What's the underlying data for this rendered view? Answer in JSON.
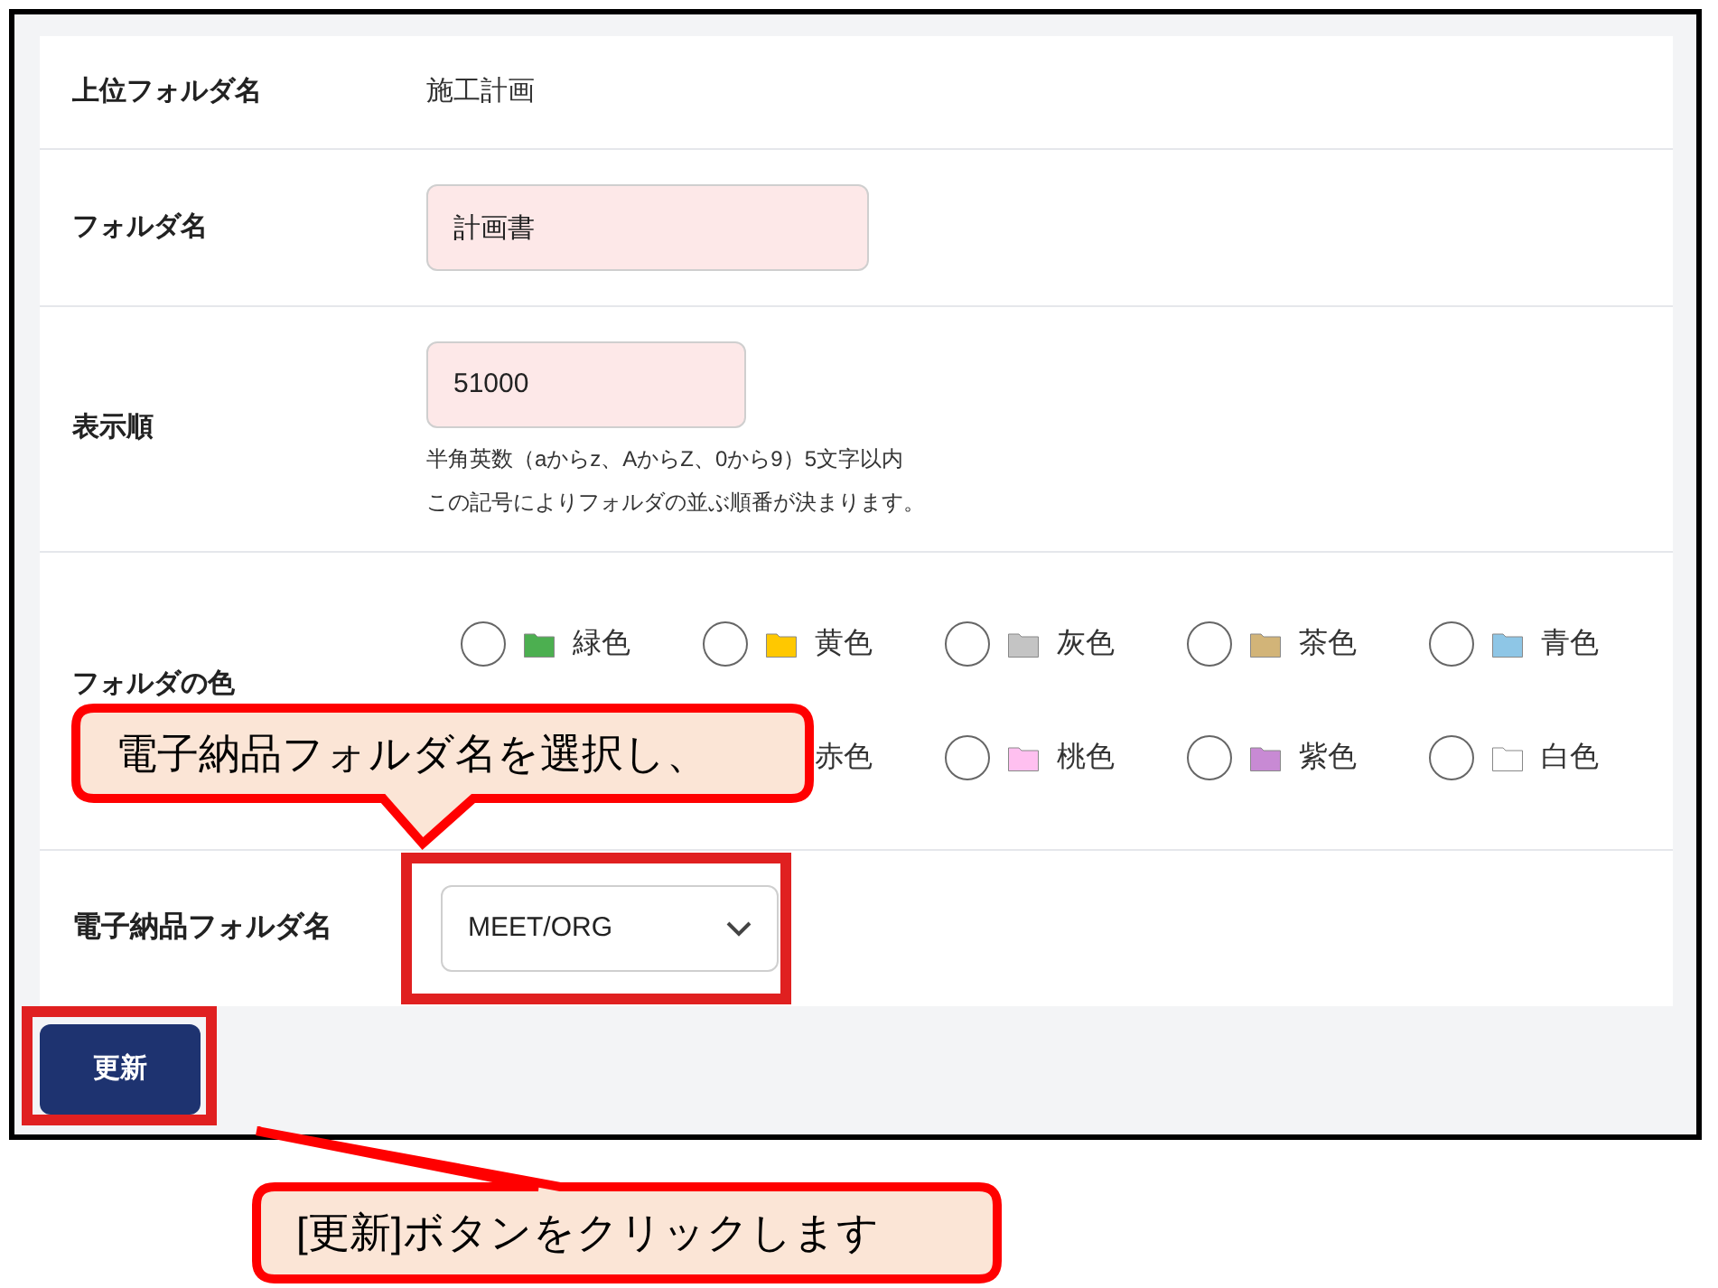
{
  "fields": [
    {
      "kind": "text",
      "label": "上位フォルダ名",
      "value": "施工計画"
    },
    {
      "kind": "input",
      "label": "フォルダ名",
      "value": "計画書"
    },
    {
      "kind": "input",
      "label": "表示順",
      "value": "51000",
      "notes": [
        "半角英数（aからz、AからZ、0から9）5文字以内",
        "この記号によりフォルダの並ぶ順番が決まります。"
      ]
    },
    {
      "kind": "colors",
      "label": "フォルダの色",
      "options": [
        {
          "label": "緑色",
          "color": "#4caf50",
          "selected": false
        },
        {
          "label": "黄色",
          "color": "#ffc800",
          "selected": false
        },
        {
          "label": "灰色",
          "color": "#c4c4c4",
          "selected": false
        },
        {
          "label": "茶色",
          "color": "#d2b478",
          "selected": false
        },
        {
          "label": "青色",
          "color": "#8ec6e6",
          "selected": false
        },
        {
          "label": "赤色"
        },
        {
          "label": "桃色",
          "color": "#ffc0f0",
          "selected": false
        },
        {
          "label": "紫色",
          "color": "#c88ad4",
          "selected": false
        },
        {
          "label": "白色",
          "color": "#ffffff",
          "selected": false
        }
      ]
    },
    {
      "kind": "select",
      "label": "電子納品フォルダ名",
      "value": "MEET/ORG"
    }
  ],
  "submit": "更新",
  "callouts": [
    "電子納品フォルダ名を選択し、",
    "[更新]ボタンをクリックします"
  ]
}
